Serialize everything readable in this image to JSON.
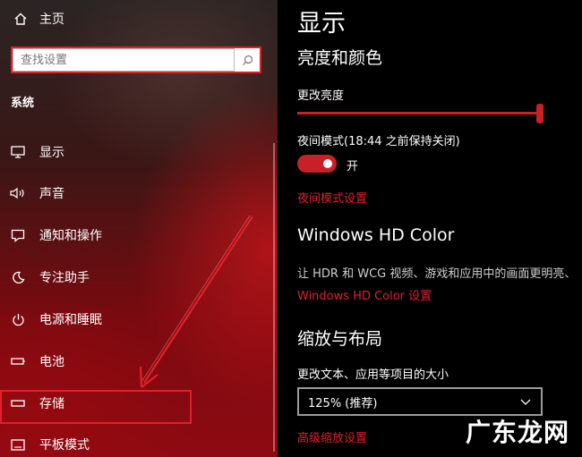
{
  "sidebar": {
    "home_label": "主页",
    "search": {
      "placeholder": "查找设置"
    },
    "section_title": "系统",
    "items": [
      {
        "label": "显示",
        "icon": "monitor-icon"
      },
      {
        "label": "声音",
        "icon": "speaker-icon"
      },
      {
        "label": "通知和操作",
        "icon": "message-icon"
      },
      {
        "label": "专注助手",
        "icon": "moon-icon"
      },
      {
        "label": "电源和睡眠",
        "icon": "power-icon"
      },
      {
        "label": "电池",
        "icon": "battery-icon"
      },
      {
        "label": "存储",
        "icon": "storage-icon"
      },
      {
        "label": "平板模式",
        "icon": "tablet-icon"
      }
    ],
    "highlighted_item": "存储"
  },
  "main": {
    "page_title": "显示",
    "brightness_section": {
      "title": "亮度和颜色",
      "brightness_label": "更改亮度",
      "brightness_value": 1.0,
      "night_mode_label": "夜间模式(18:44 之前保持关闭)",
      "night_mode_toggle": {
        "state": "on",
        "text": "开"
      },
      "night_mode_link": "夜间模式设置"
    },
    "hdr_section": {
      "title": "Windows HD Color",
      "description": "让 HDR 和 WCG 视频、游戏和应用中的画面更明亮、",
      "link": "Windows HD Color 设置"
    },
    "scale_section": {
      "title": "缩放与布局",
      "scale_label": "更改文本、应用等项目的大小",
      "scale_value": "125% (推荐)",
      "advanced_link": "高级缩放设置"
    }
  },
  "watermark": "广东龙网",
  "colors": {
    "accent": "#c91f26",
    "highlight_border": "#e1202a",
    "main_background": "#000000"
  }
}
